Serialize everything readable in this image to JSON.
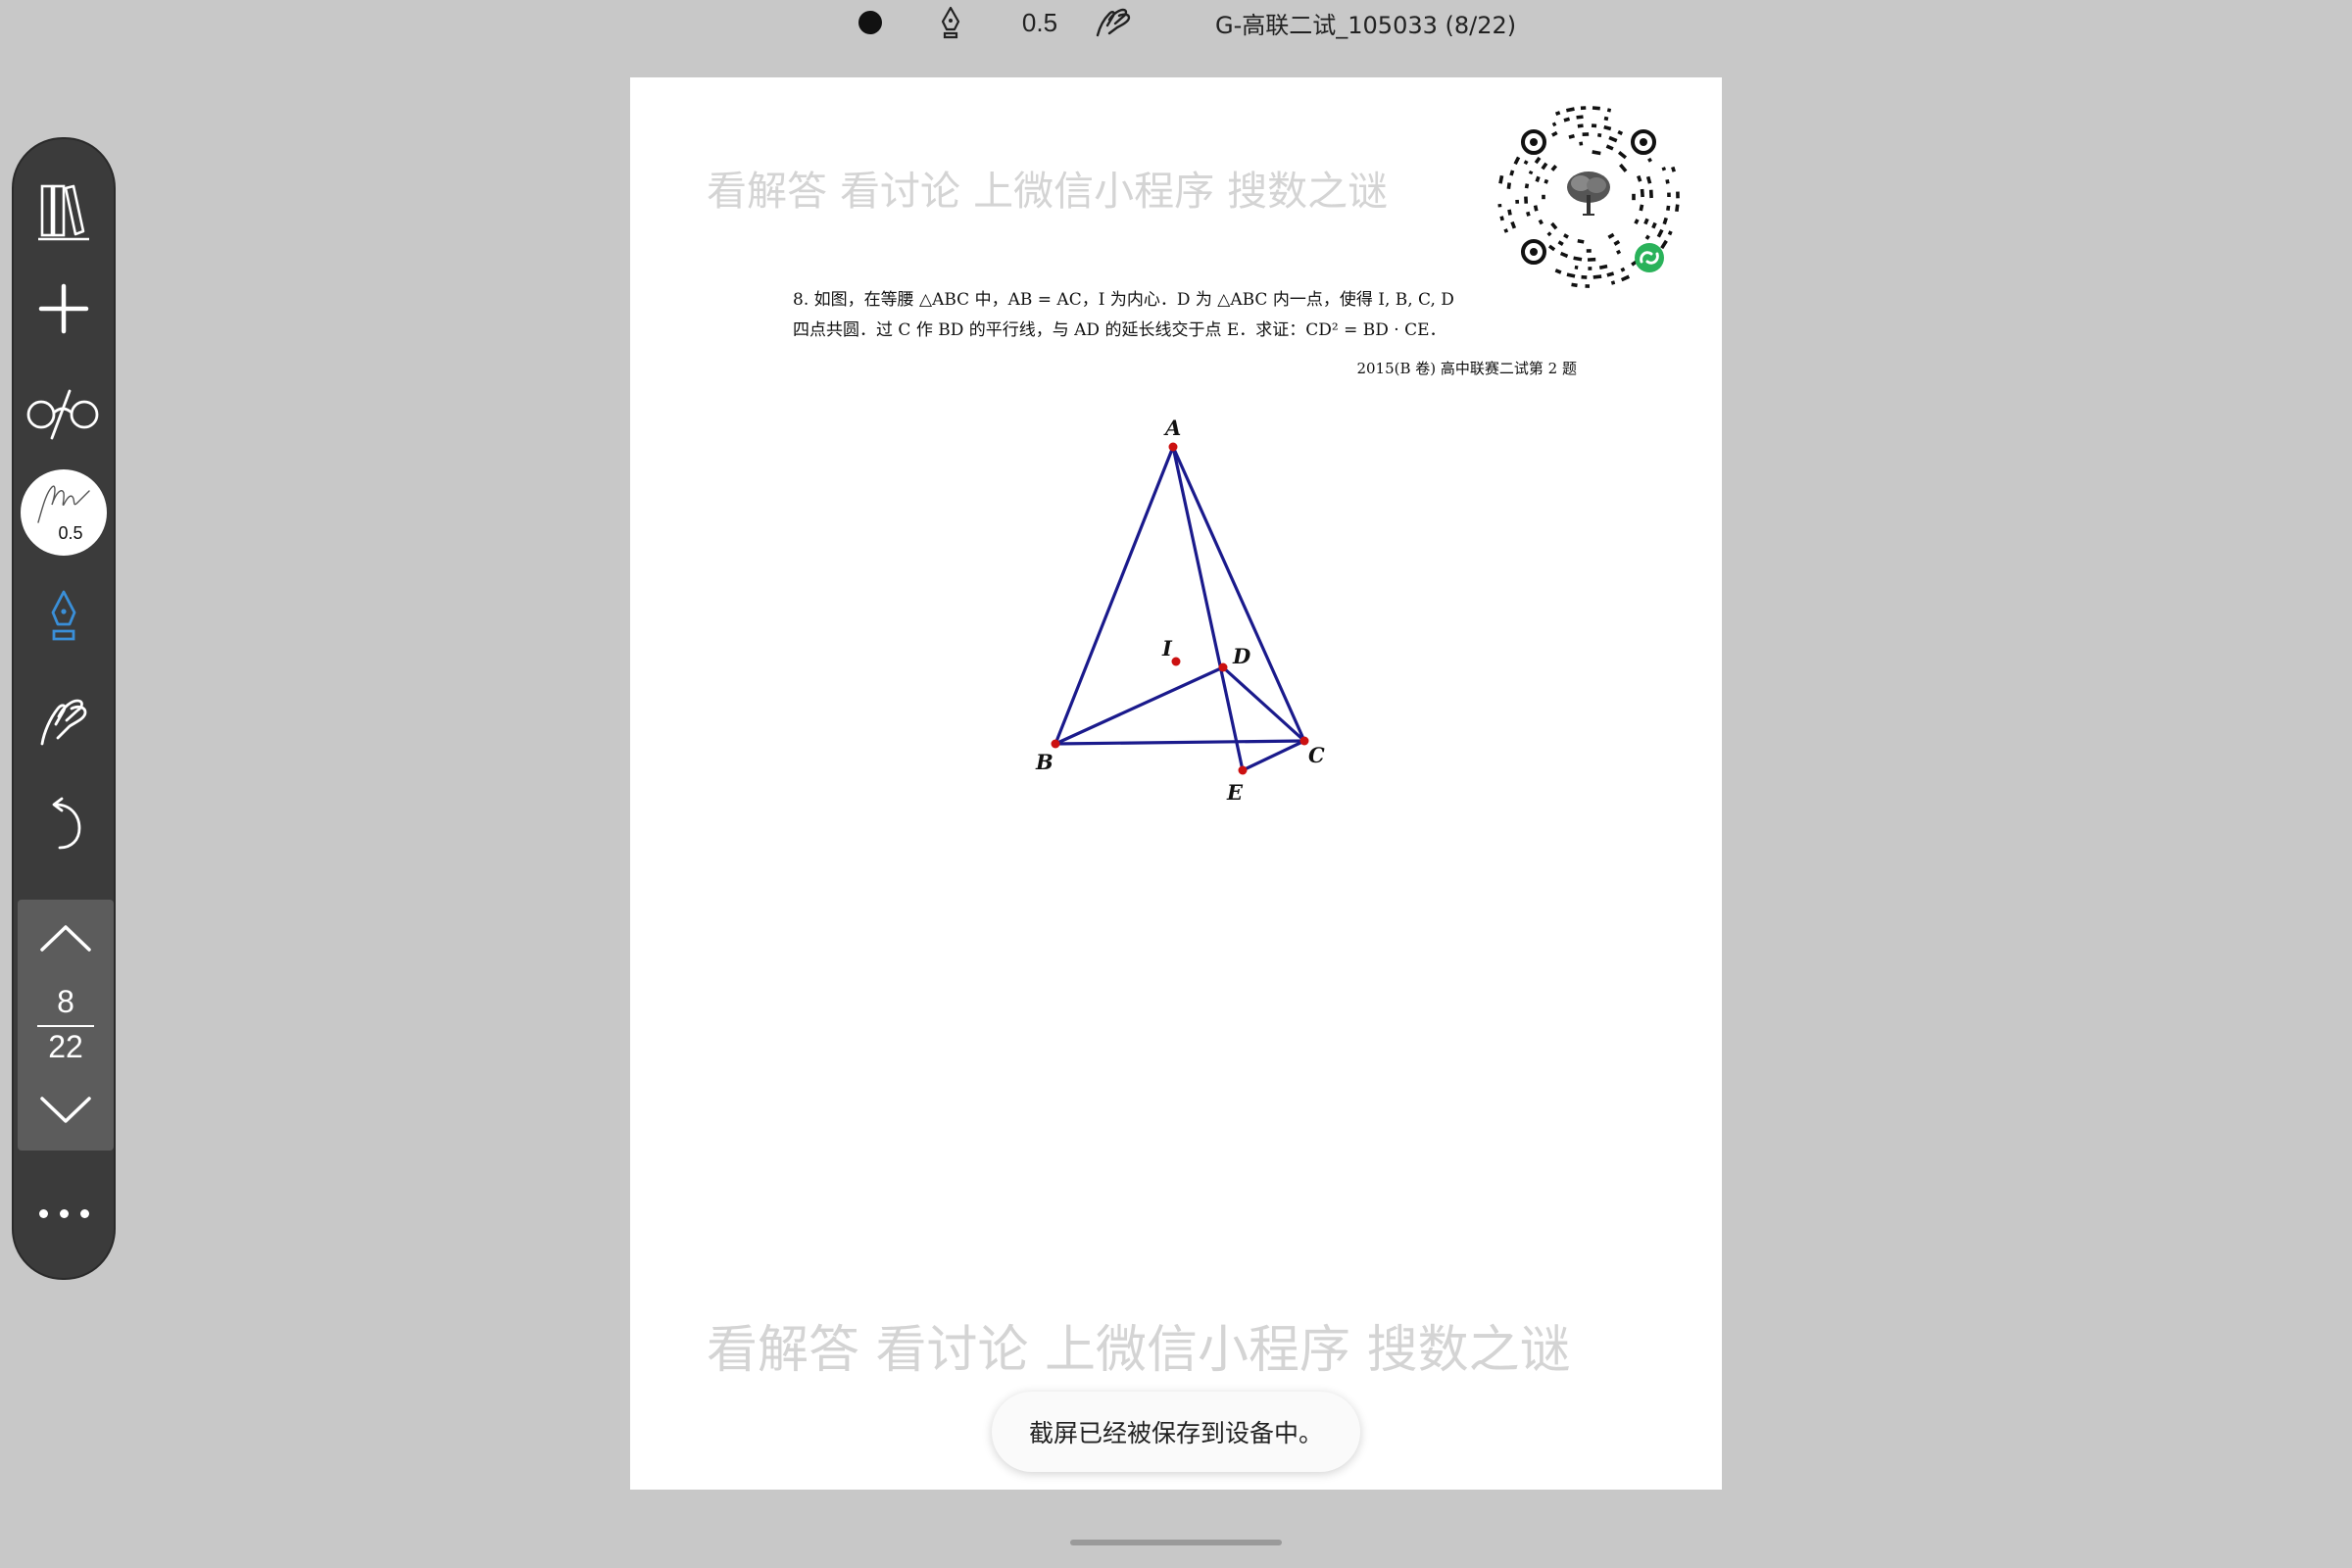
{
  "toolbar": {
    "color_icon": "filled-circle-icon",
    "pen_icon": "fountain-pen-icon",
    "stroke_size": "0.5",
    "hand_icon": "hand-draw-icon",
    "document_title": "G-高联二试_105033 (8/22)"
  },
  "sidebar": {
    "items": [
      {
        "name": "library",
        "icon": "books-icon"
      },
      {
        "name": "add",
        "icon": "plus-icon"
      },
      {
        "name": "view",
        "icon": "glasses-icon"
      },
      {
        "name": "brush",
        "icon": "signature-icon",
        "size": "0.5"
      },
      {
        "name": "pen",
        "icon": "fountain-pen-icon",
        "color": "#3a8fd8"
      },
      {
        "name": "hand",
        "icon": "hand-draw-icon"
      },
      {
        "name": "undo",
        "icon": "undo-icon"
      }
    ],
    "pager": {
      "current": "8",
      "total": "22",
      "up_icon": "chevron-up-icon",
      "down_icon": "chevron-down-icon"
    },
    "more_icon": "more-dots-icon"
  },
  "page": {
    "watermark_top": "看解答 看讨论 上微信小程序 搜数之谜",
    "watermark_bottom": "看解答 看讨论 上微信小程序 搜数之谜",
    "problem_line1": "8.  如图，在等腰 △ABC 中，AB = AC，I 为内心．D 为 △ABC 内一点，使得 I, B, C, D",
    "problem_line2": "四点共圆．过 C 作 BD 的平行线，与 AD 的延长线交于点 E．求证：CD² = BD · CE．",
    "source": "2015(B 卷) 高中联赛二试第 2 题",
    "figure": {
      "labels": {
        "A": "A",
        "B": "B",
        "C": "C",
        "D": "D",
        "E": "E",
        "I": "I"
      },
      "line_color": "#1a1a8c",
      "point_color": "#cc1111"
    }
  },
  "toast": {
    "text": "截屏已经被保存到设备中。"
  }
}
